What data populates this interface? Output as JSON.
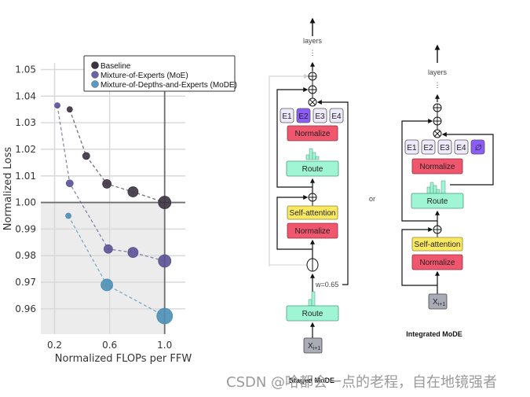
{
  "chart_data": {
    "type": "scatter",
    "title": "",
    "xlabel": "Normalized FLOPs per FFW",
    "ylabel": "Normalized Loss",
    "xlim": [
      0.1,
      1.15
    ],
    "ylim": [
      0.9505,
      1.0525
    ],
    "xticks": [
      0.2,
      0.6,
      1.0
    ],
    "xtick_labels": [
      "0.2",
      "0.6",
      "1.0"
    ],
    "yticks": [
      0.96,
      0.97,
      0.98,
      0.99,
      1.0,
      1.01,
      1.02,
      1.03,
      1.04,
      1.05
    ],
    "ytick_labels": [
      "0.96",
      "0.97",
      "0.98",
      "0.99",
      "1.00",
      "1.01",
      "1.02",
      "1.03",
      "1.04",
      "1.05"
    ],
    "grid": true,
    "shaded_region": "loss below 1.00",
    "reference_lines": {
      "x": 1.0,
      "y": 1.0
    },
    "legend_position": "top-right",
    "series": [
      {
        "name": "Baseline",
        "color": "#3b3340",
        "line_style": "dashed",
        "x": [
          0.31,
          0.43,
          0.58,
          0.77,
          1.0
        ],
        "y": [
          1.035,
          1.0175,
          1.007,
          1.004,
          1.0
        ],
        "marker_size_rank": [
          1,
          2,
          3,
          4,
          5
        ]
      },
      {
        "name": "Mixture-of-Experts (MoE)",
        "color": "#5a5294",
        "line_style": "dashed",
        "x": [
          0.22,
          0.31,
          0.59,
          0.77,
          1.0
        ],
        "y": [
          1.0365,
          1.0072,
          0.9825,
          0.9812,
          0.978
        ],
        "marker_size_rank": [
          1,
          2,
          3,
          4,
          5
        ]
      },
      {
        "name": "Mixture-of-Depths-and-Experts (MoDE)",
        "color": "#4d8fb5",
        "line_style": "dashed",
        "x": [
          0.3,
          0.58,
          1.0
        ],
        "y": [
          0.995,
          0.969,
          0.9573
        ],
        "marker_size_rank": [
          1,
          3,
          5
        ]
      }
    ]
  },
  "diagram": {
    "staged": {
      "caption": "Staged MoDE",
      "layers_label": "layers",
      "dots": "⋮",
      "experts": [
        "E1",
        "E2",
        "E3",
        "E4"
      ],
      "active_expert_index": 1,
      "normalize_label": "Normalize",
      "route_label": "Route",
      "self_attention_label": "Self-attention",
      "weight_label": "w=0.65",
      "input_label": "X",
      "input_subscript": "i+1"
    },
    "or_label": "or",
    "integrated": {
      "caption": "Integrated MoDE",
      "layers_label": "layers",
      "dots": "⋮",
      "experts": [
        "E1",
        "E2",
        "E3",
        "E4"
      ],
      "noop_expert_symbol": "∅",
      "normalize_label": "Normalize",
      "route_label": "Route",
      "self_attention_label": "Self-attention",
      "input_label": "X",
      "input_subscript": "i+1"
    }
  },
  "colors": {
    "normalize": "#f0566e",
    "route": "#9ff5d4",
    "self_attention": "#fbe963",
    "expert": "#eee9fb",
    "expert_active": "#8b5cf6",
    "input": "#a9acb6",
    "plot_bg_shaded": "#ececec"
  },
  "watermark": "CSDN @哈都会一点的老程，自在地镜强者"
}
